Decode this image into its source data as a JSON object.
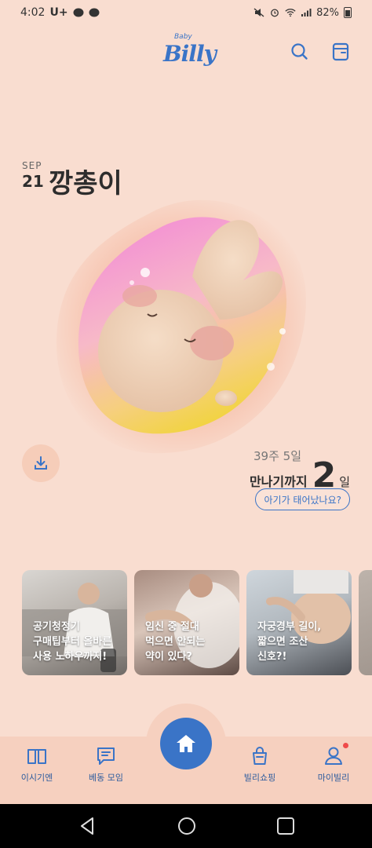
{
  "status_bar": {
    "time": "4:02",
    "carrier": "U+",
    "battery": "82%"
  },
  "header": {
    "logo_small": "Baby",
    "logo_big": "Billy"
  },
  "profile": {
    "month": "SEP",
    "day": "21",
    "baby_name": "깡총이"
  },
  "pregnancy": {
    "weeks_text": "39주 5일",
    "dday_label": "만나기까지",
    "dday_number": "2",
    "dday_unit": "일",
    "born_button": "아기가 태어났나요?"
  },
  "cards": [
    {
      "title": "공기청정기\n구매팁부터 올바른\n사용 노하우까지!"
    },
    {
      "title": "임신 중 절대\n먹으면 안되는\n약이 있다?"
    },
    {
      "title": "자궁경부 길이,\n짧으면 조산\n신호?!"
    }
  ],
  "nav": {
    "items": [
      "이시기엔",
      "베동 모임",
      "빌리쇼핑",
      "마이빌리"
    ]
  },
  "colors": {
    "accent": "#3a74c7",
    "background": "#f9ddd0",
    "notification": "#ef4a4a"
  }
}
